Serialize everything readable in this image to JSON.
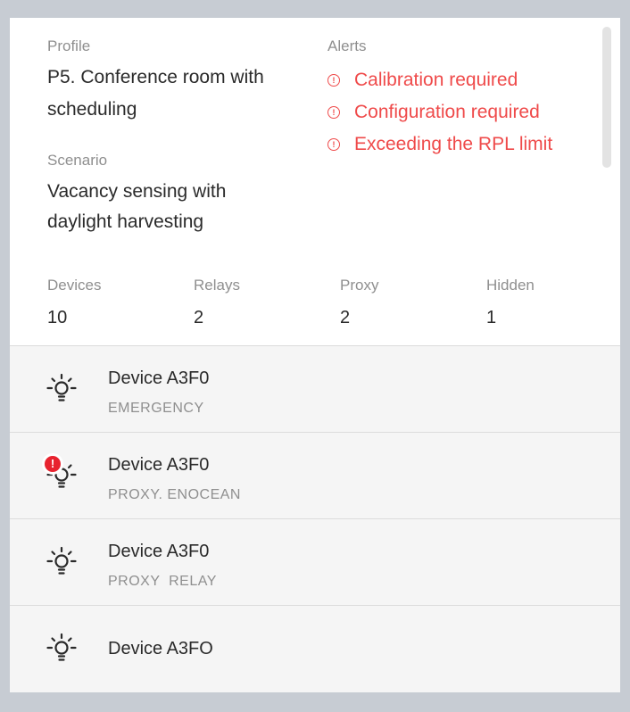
{
  "profile": {
    "label": "Profile",
    "value_line1": "P5. Conference room with",
    "value_line2": "scheduling"
  },
  "scenario": {
    "label": "Scenario",
    "value_line1": "Vacancy sensing with",
    "value_line2": "daylight harvesting"
  },
  "alerts": {
    "label": "Alerts",
    "items": [
      "Calibration required",
      "Configuration required",
      "Exceeding the RPL limit"
    ],
    "icon": "error-outline-icon",
    "color": "#ef4a4a"
  },
  "stats": [
    {
      "label": "Devices",
      "value": "10"
    },
    {
      "label": "Relays",
      "value": "2"
    },
    {
      "label": "Proxy",
      "value": "2"
    },
    {
      "label": "Hidden",
      "value": "1"
    }
  ],
  "devices": [
    {
      "name": "Device A3F0",
      "type": "EMERGENCY",
      "icon": "lightbulb-icon",
      "error": false
    },
    {
      "name": "Device A3F0",
      "type": "PROXY. ENOCEAN",
      "icon": "lightbulb-icon",
      "error": true,
      "error_glyph": "!"
    },
    {
      "name": "Device A3F0",
      "type": "PROXY  RELAY",
      "icon": "lightbulb-icon",
      "error": false
    },
    {
      "name": "Device A3FO",
      "type": "",
      "icon": "lightbulb-icon",
      "error": false
    }
  ],
  "colors": {
    "background": "#c7ccd3",
    "alert": "#ef4a4a",
    "error_badge": "#e8232f",
    "list_bg": "#f5f5f5"
  }
}
